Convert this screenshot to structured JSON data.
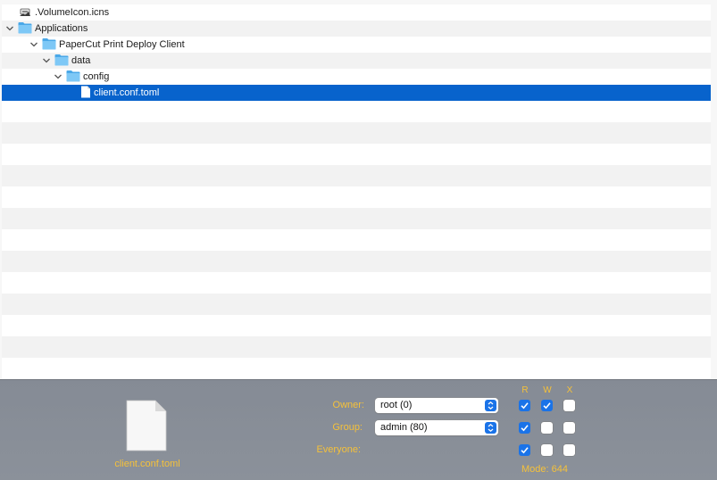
{
  "tree": {
    "rows": [
      {
        "label": ".VolumeIcon.icns",
        "icon": "volume-icon"
      },
      {
        "label": "Applications",
        "icon": "folder-icon",
        "expanded": true
      },
      {
        "label": "PaperCut Print Deploy Client",
        "icon": "folder-icon",
        "expanded": true
      },
      {
        "label": "data",
        "icon": "folder-icon",
        "expanded": true
      },
      {
        "label": "config",
        "icon": "folder-icon",
        "expanded": true
      },
      {
        "label": "client.conf.toml",
        "icon": "document-icon",
        "selected": true
      }
    ]
  },
  "inspector": {
    "file_name": "client.conf.toml",
    "file_icon": "document-icon",
    "headers": {
      "r": "R",
      "w": "W",
      "x": "X"
    },
    "owner": {
      "label": "Owner:",
      "value": "root (0)",
      "r": true,
      "w": true,
      "x": false
    },
    "group": {
      "label": "Group:",
      "value": "admin (80)",
      "r": true,
      "w": false,
      "x": false
    },
    "everyone": {
      "label": "Everyone:",
      "r": true,
      "w": false,
      "x": false
    },
    "mode": "Mode: 644"
  },
  "colors": {
    "selection": "#0863cc",
    "accent": "#1a73e8",
    "label_yellow": "#f5c13a"
  }
}
